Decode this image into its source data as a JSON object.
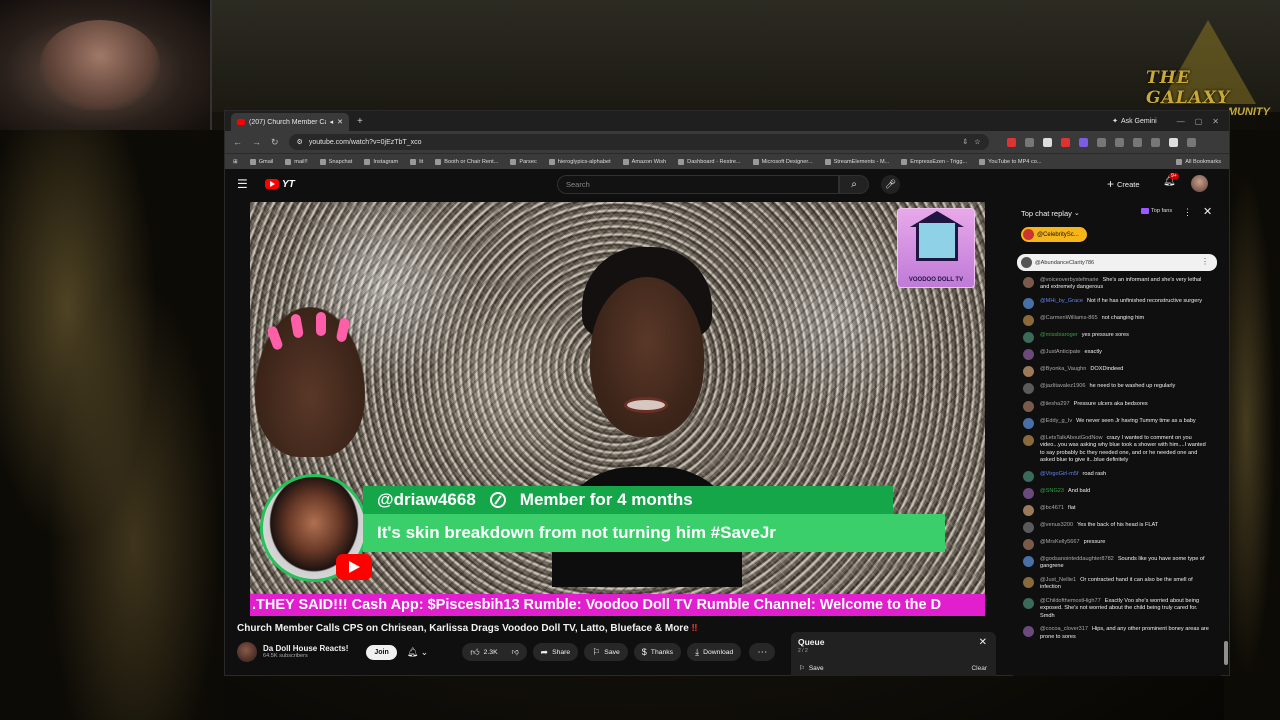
{
  "browser": {
    "tab_title": "(207) Church Member Calls",
    "url": "youtube.com/watch?v=0jEzTbT_xco",
    "gemini_label": "Ask Gemini",
    "bookmarks": [
      "Gmail",
      "mail!!",
      "Snapchat",
      "Instagram",
      "lit",
      "Booth or Chair Rent...",
      "Parsec",
      "hieroglypics-alphabet",
      "Amazon Wish",
      "Dashboard - Restre...",
      "Microsoft Designer...",
      "StreamElements - M...",
      "EmpressEzen - Trigg...",
      "YouTube to MP4 co..."
    ],
    "all_bookmarks": "All Bookmarks"
  },
  "overlay": {
    "logo_text": "THE GALAXY",
    "logo_sub": "MUNITY"
  },
  "youtube": {
    "search_placeholder": "Search",
    "create_label": "Create",
    "notif_count": "9+"
  },
  "video": {
    "badge_title": "VOODOO DOLL TV",
    "superchat": {
      "handle": "@driaw4668",
      "member": "Member for 4 months",
      "message": "It's skin breakdown from not turning him #SaveJr"
    },
    "ticker": ".THEY SAID!!! Cash App: $Piscesbih13 Rumble: Voodoo Doll TV Rumble Channel: Welcome to the D"
  },
  "meta": {
    "title": "Church Member Calls CPS on Chrisean, Karlissa Drags Voodoo Doll TV, Latto, Blueface & More",
    "title_bang": "‼",
    "channel": "Da Doll House Reacts!",
    "subs": "64.5K subscribers",
    "join": "Join",
    "likes": "2.3K",
    "share": "Share",
    "save": "Save",
    "thanks": "Thanks",
    "download": "Download"
  },
  "queue": {
    "title": "Queue",
    "count": "2 / 2",
    "save": "Save",
    "clear": "Clear"
  },
  "chat": {
    "header": "Top chat replay",
    "top_fans": "Top fans",
    "pinned": "@CelebritySc...",
    "banner_user": "@AbundanceClarity786",
    "messages": [
      {
        "author": "@voiceoverbystefmarie",
        "text": "She's an informant and she's very lethal and extremely dangerous",
        "color": "norm"
      },
      {
        "author": "@MHi_by_Grace",
        "text": "Not if he has unfinished reconstructive surgery",
        "color": "blu"
      },
      {
        "author": "@CarmenWilliams-865",
        "text": "not changing him",
        "color": "norm"
      },
      {
        "author": "@missbiaroger",
        "text": "yes pressure sores",
        "color": "grn"
      },
      {
        "author": "@JustAnticipate",
        "text": "exactly",
        "color": "norm"
      },
      {
        "author": "@Byonka_Vaughn",
        "text": "DOXDindeed",
        "color": "norm"
      },
      {
        "author": "@jazlitavalez1906",
        "text": "he need to be washed up regularly",
        "color": "norm"
      },
      {
        "author": "@iiesha297",
        "text": "Pressure ulcers aka bedsores",
        "color": "norm"
      },
      {
        "author": "@Eddy_g_Iv",
        "text": "We never seen Jr having Tummy time as a baby",
        "color": "norm"
      },
      {
        "author": "@LetsTalkAboutGodNow",
        "text": "crazy I wanted to comment on you video...you was asking why blue took a shower with him....I wanted to say probably bc they needed one, and or he needed one and asked blue to give it...blue definitely",
        "color": "norm"
      },
      {
        "author": "@VirgoGirl-m5f",
        "text": "road rash",
        "color": "blu"
      },
      {
        "author": "@SNG23",
        "text": "And bald",
        "color": "grn"
      },
      {
        "author": "@bc4671",
        "text": "flat",
        "color": "norm"
      },
      {
        "author": "@venus3200",
        "text": "Yes the back of his head is FLAT",
        "color": "norm"
      },
      {
        "author": "@MrsKelly5667",
        "text": "pressure",
        "color": "norm"
      },
      {
        "author": "@godsanointeddaughter8782",
        "text": "Sounds like you have some type of gangrene",
        "color": "norm"
      },
      {
        "author": "@Just_Nellie1",
        "text": "Or contracted hand it can also be the smell of infection",
        "color": "norm"
      },
      {
        "author": "@ChildofthemostHigh77",
        "text": "Exactly Voo she's worried about being exposed. She's not worried about the child being truly cared for. Smdh",
        "color": "norm"
      },
      {
        "author": "@cocoa_clover317",
        "text": "Hips, and any other prominent boney areas are prone to sores",
        "color": "norm"
      }
    ]
  }
}
